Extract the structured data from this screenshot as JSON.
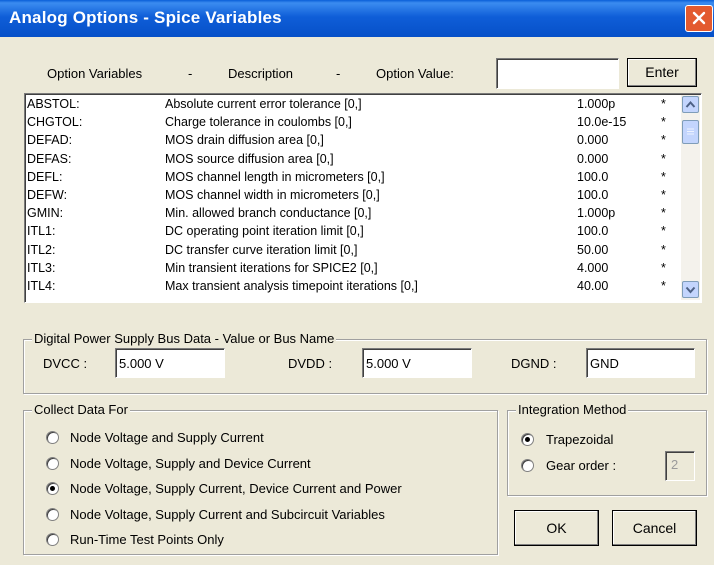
{
  "window": {
    "title": "Analog Options - Spice Variables"
  },
  "header": {
    "option_variables": "Option Variables",
    "sep1": "-",
    "description": "Description",
    "sep2": "-",
    "option_value": "Option Value:",
    "value_input": "",
    "enter_label": "Enter"
  },
  "options": [
    {
      "name": "ABSTOL:",
      "desc": "Absolute current error tolerance [0,]",
      "value": "1.000p",
      "mark": "*"
    },
    {
      "name": "CHGTOL:",
      "desc": "Charge tolerance in coulombs [0,]",
      "value": "10.0e-15",
      "mark": "*"
    },
    {
      "name": "DEFAD:",
      "desc": "MOS drain diffusion area [0,]",
      "value": "0.000",
      "mark": "*"
    },
    {
      "name": "DEFAS:",
      "desc": "MOS source diffusion area [0,]",
      "value": "0.000",
      "mark": "*"
    },
    {
      "name": "DEFL:",
      "desc": "MOS channel length in micrometers [0,]",
      "value": "100.0",
      "mark": "*"
    },
    {
      "name": "DEFW:",
      "desc": "MOS channel width in micrometers [0,]",
      "value": "100.0",
      "mark": "*"
    },
    {
      "name": "GMIN:",
      "desc": "Min. allowed branch conductance [0,]",
      "value": "1.000p",
      "mark": "*"
    },
    {
      "name": "ITL1:",
      "desc": "DC operating point iteration limit [0,]",
      "value": "100.0",
      "mark": "*"
    },
    {
      "name": "ITL2:",
      "desc": "DC transfer curve iteration limit [0,]",
      "value": "50.00",
      "mark": "*"
    },
    {
      "name": "ITL3:",
      "desc": "Min transient iterations for SPICE2 [0,]",
      "value": "4.000",
      "mark": "*"
    },
    {
      "name": "ITL4:",
      "desc": "Max transient analysis timepoint iterations [0,]",
      "value": "40.00",
      "mark": "*"
    }
  ],
  "digital": {
    "legend": "Digital Power Supply Bus Data - Value or Bus Name",
    "dvcc_label": "DVCC :",
    "dvcc_value": "5.000 V",
    "dvdd_label": "DVDD :",
    "dvdd_value": "5.000 V",
    "dgnd_label": "DGND :",
    "dgnd_value": "GND"
  },
  "collect": {
    "legend": "Collect Data For",
    "options": [
      "Node Voltage and Supply Current",
      "Node Voltage, Supply and Device Current",
      "Node Voltage, Supply Current, Device Current and Power",
      "Node Voltage, Supply Current and Subcircuit Variables",
      "Run-Time Test Points Only"
    ],
    "selected_index": 2
  },
  "integration": {
    "legend": "Integration Method",
    "trapezoidal": "Trapezoidal",
    "gear": "Gear order :",
    "gear_order": "2",
    "selected": "Trapezoidal"
  },
  "buttons": {
    "ok": "OK",
    "cancel": "Cancel"
  }
}
